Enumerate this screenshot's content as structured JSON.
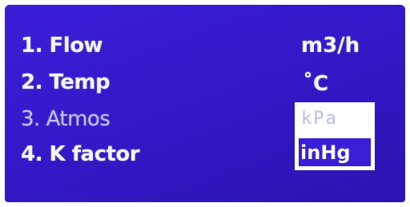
{
  "menu": {
    "items": [
      {
        "label": "1. Flow",
        "value": "m3/h"
      },
      {
        "label": "2. Temp",
        "value": "˚C"
      },
      {
        "label": "3. Atmos"
      },
      {
        "label": "4. K  factor"
      }
    ]
  },
  "unit_dropdown": {
    "options": [
      "kPa",
      "inHg"
    ],
    "selected": "inHg"
  },
  "colors": {
    "screen_background": "#3419c9",
    "text": "#f4f4ff",
    "dim_text": "#bfc2ee",
    "dropdown_background": "#ffffff",
    "highlight": "#3a1fd8"
  }
}
